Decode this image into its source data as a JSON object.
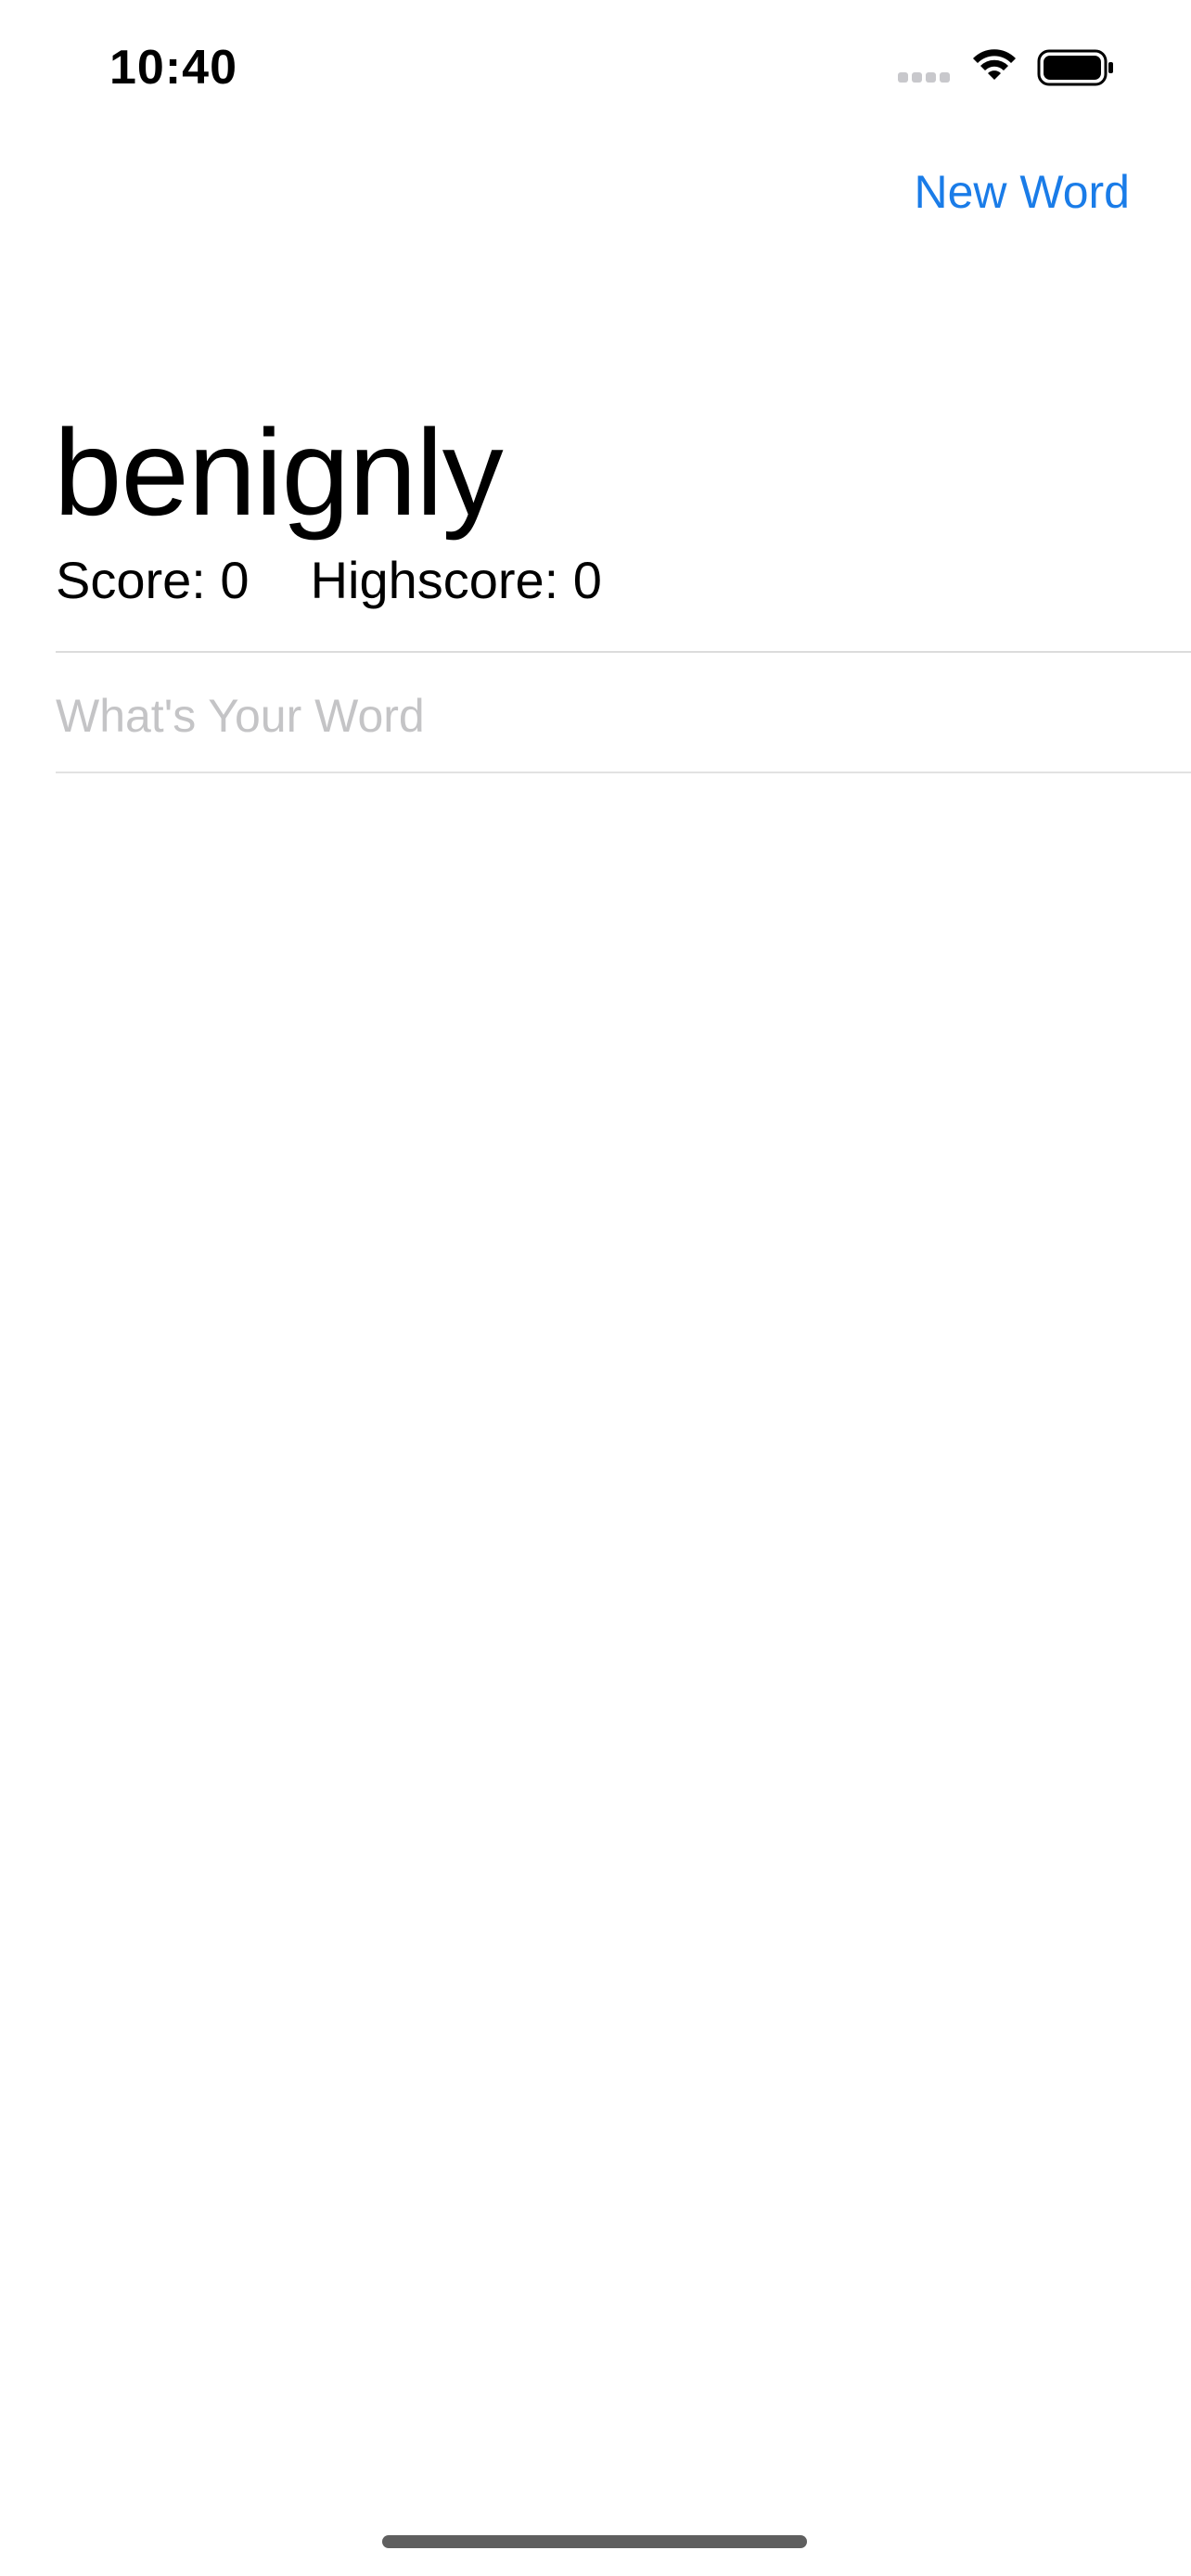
{
  "status_bar": {
    "time": "10:40",
    "icons": [
      "signal-icon",
      "wifi-icon",
      "battery-icon"
    ]
  },
  "nav": {
    "new_word_label": "New Word"
  },
  "game": {
    "root_word": "benignly",
    "score_label": "Score: 0",
    "highscore_label": "Highscore: 0"
  },
  "input": {
    "placeholder": "What's Your Word",
    "value": ""
  },
  "colors": {
    "accent": "#1a7ce8",
    "placeholder": "#c4c4c6",
    "divider": "#dcdcdc",
    "background": "#ffffff",
    "text": "#000000"
  }
}
